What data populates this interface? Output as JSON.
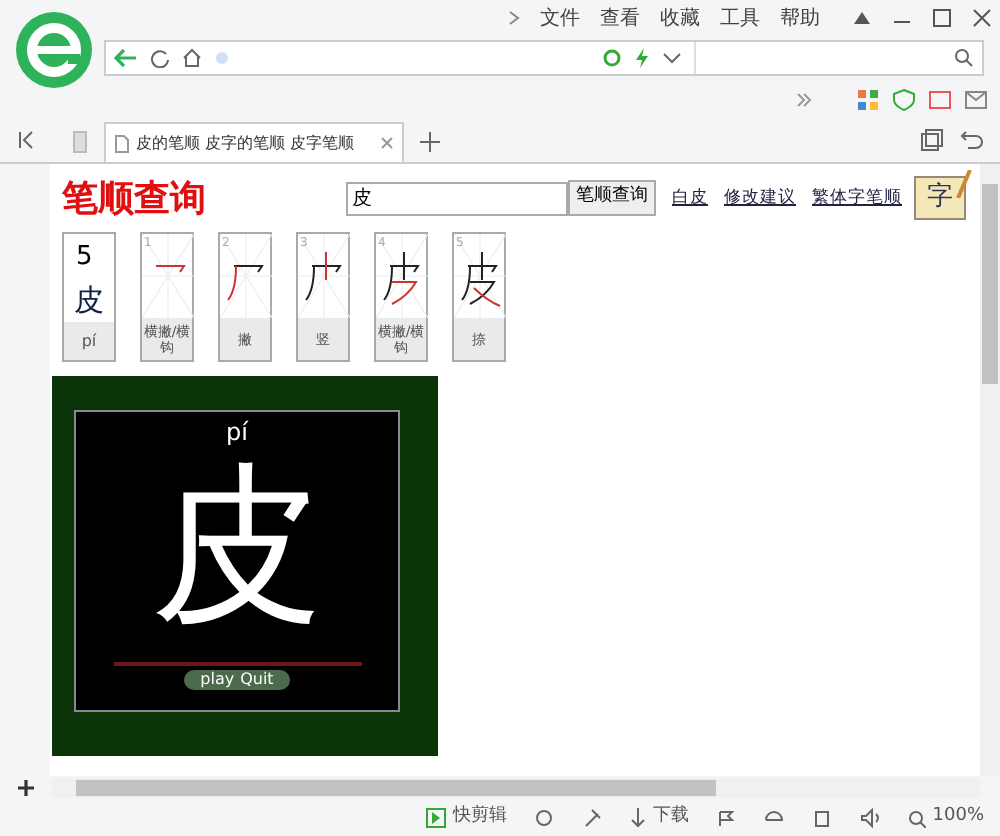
{
  "menu": [
    "文件",
    "查看",
    "收藏",
    "工具",
    "帮助"
  ],
  "tabs": [
    {
      "label": "皮的笔顺 皮字的笔顺 皮字笔顺",
      "selected": true
    }
  ],
  "page": {
    "title": "笔顺查询",
    "logo_text": "字",
    "search": {
      "value": "皮"
    },
    "search_button": "笔顺查询",
    "links": [
      "白皮",
      "修改建议",
      "繁体字笔顺"
    ],
    "summary": {
      "count": "5",
      "character": "皮",
      "pinyin": "pí"
    },
    "strokes": [
      {
        "number": "1",
        "name": "横撇/横钩"
      },
      {
        "number": "2",
        "name": "撇"
      },
      {
        "number": "3",
        "name": "竖"
      },
      {
        "number": "4",
        "name": "横撇/横钩"
      },
      {
        "number": "5",
        "name": "捺"
      }
    ],
    "player": {
      "pinyin": "pí",
      "character": "皮",
      "buttons": [
        "play",
        "Quit"
      ]
    }
  },
  "status_bar": {
    "items": [
      {
        "kind": "clip",
        "label": "快剪辑"
      },
      {
        "kind": "icon"
      },
      {
        "kind": "icon"
      },
      {
        "kind": "download",
        "label": "下载"
      },
      {
        "kind": "icon"
      },
      {
        "kind": "icon"
      },
      {
        "kind": "icon"
      },
      {
        "kind": "icon"
      },
      {
        "kind": "zoom",
        "label": "100%"
      }
    ]
  }
}
